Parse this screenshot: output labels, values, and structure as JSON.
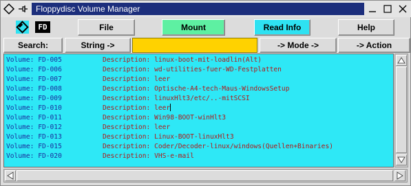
{
  "window": {
    "title": "Floppydisc Volume Manager"
  },
  "icons": {
    "fd_label": "FD"
  },
  "toolbar": {
    "file_label": "File",
    "mount_label": "Mount",
    "readinfo_label": "Read Info",
    "help_label": "Help"
  },
  "search_bar": {
    "search_label": "Search:",
    "string_label": "String ->",
    "input_value": "",
    "mode_label": "-> Mode ->",
    "action_label": "-> Action"
  },
  "volumes": [
    {
      "volume": "Volume: FD-005",
      "description": "Description: linux-boot-mit-loadlin(Alt)"
    },
    {
      "volume": "Volume: FD-006",
      "description": "Description: wd-utilities-fuer-WD-Festplatten"
    },
    {
      "volume": "Volume: FD-007",
      "description": "Description: leer"
    },
    {
      "volume": "Volume: FD-008",
      "description": "Description: Optische-A4-tech-Maus-WindowsSetup"
    },
    {
      "volume": "Volume: FD-009",
      "description": "Description: linuxHlt3/etc/..-mitSCSI"
    },
    {
      "volume": "Volume: FD-010",
      "description": "Description: leer"
    },
    {
      "volume": "Volume: FD-011",
      "description": "Description: Win98-BOOT-winHlt3"
    },
    {
      "volume": "Volume: FD-012",
      "description": "Description: leer"
    },
    {
      "volume": "Volume: FD-013",
      "description": "Description: Linux-BOOT-linuxHlt3"
    },
    {
      "volume": "Volume: FD-015",
      "description": "Description: Coder/Decoder-linux/windows(Quellen+Binaries)"
    },
    {
      "volume": "Volume: FD-020",
      "description": "Description: VHS-e-mail"
    }
  ],
  "colors": {
    "title_bg": "#1c2e7c",
    "list_bg": "#2ee8f6",
    "volume_text": "#1b2c9c",
    "description_text": "#b01818",
    "mount_button": "#5ef0a2",
    "readinfo_button": "#2ee2f2",
    "search_input": "#ffd200"
  }
}
